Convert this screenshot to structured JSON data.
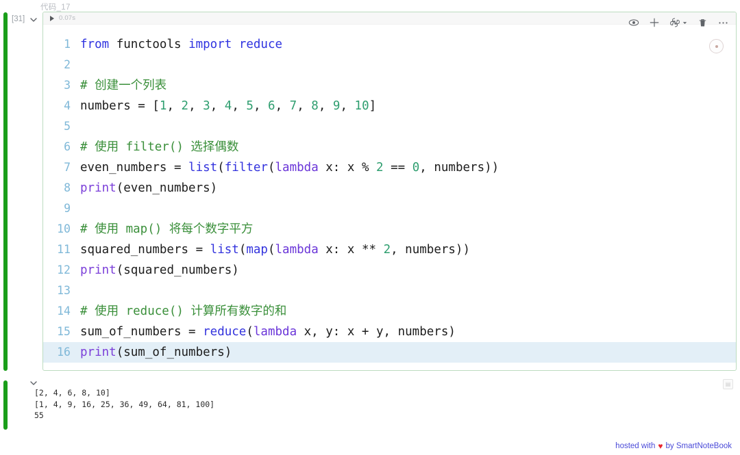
{
  "cell": {
    "label": "代码_17",
    "exec_count": "[31]",
    "exec_time": "0.07s",
    "border_color": "#bcdcc0",
    "run_bar_color": "#1a9e1a"
  },
  "toolbar": {
    "eye": "eye-icon",
    "add": "plus-icon",
    "kernel": "python-kernel-icon",
    "kernel_chevron": "chevron-down-icon",
    "delete": "trash-icon",
    "more": "ellipsis-icon",
    "kernel_status": "kernel-status-icon"
  },
  "code": {
    "language": "python",
    "highlight_line": 16,
    "lines": [
      {
        "n": "1",
        "tokens": [
          {
            "t": "from",
            "c": "kw"
          },
          {
            "t": " functools ",
            "c": "plain"
          },
          {
            "t": "import",
            "c": "kw"
          },
          {
            "t": " ",
            "c": "plain"
          },
          {
            "t": "reduce",
            "c": "kw"
          }
        ]
      },
      {
        "n": "2",
        "tokens": []
      },
      {
        "n": "3",
        "tokens": [
          {
            "t": "# 创建一个列表",
            "c": "com"
          }
        ]
      },
      {
        "n": "4",
        "tokens": [
          {
            "t": "numbers = [",
            "c": "plain"
          },
          {
            "t": "1",
            "c": "num"
          },
          {
            "t": ", ",
            "c": "plain"
          },
          {
            "t": "2",
            "c": "num"
          },
          {
            "t": ", ",
            "c": "plain"
          },
          {
            "t": "3",
            "c": "num"
          },
          {
            "t": ", ",
            "c": "plain"
          },
          {
            "t": "4",
            "c": "num"
          },
          {
            "t": ", ",
            "c": "plain"
          },
          {
            "t": "5",
            "c": "num"
          },
          {
            "t": ", ",
            "c": "plain"
          },
          {
            "t": "6",
            "c": "num"
          },
          {
            "t": ", ",
            "c": "plain"
          },
          {
            "t": "7",
            "c": "num"
          },
          {
            "t": ", ",
            "c": "plain"
          },
          {
            "t": "8",
            "c": "num"
          },
          {
            "t": ", ",
            "c": "plain"
          },
          {
            "t": "9",
            "c": "num"
          },
          {
            "t": ", ",
            "c": "plain"
          },
          {
            "t": "10",
            "c": "num"
          },
          {
            "t": "]",
            "c": "plain"
          }
        ]
      },
      {
        "n": "5",
        "tokens": []
      },
      {
        "n": "6",
        "tokens": [
          {
            "t": "# 使用 filter() 选择偶数",
            "c": "com"
          }
        ]
      },
      {
        "n": "7",
        "tokens": [
          {
            "t": "even_numbers = ",
            "c": "plain"
          },
          {
            "t": "list",
            "c": "builtin"
          },
          {
            "t": "(",
            "c": "plain"
          },
          {
            "t": "filter",
            "c": "builtin"
          },
          {
            "t": "(",
            "c": "plain"
          },
          {
            "t": "lambda",
            "c": "lambda"
          },
          {
            "t": " x: x % ",
            "c": "plain"
          },
          {
            "t": "2",
            "c": "num"
          },
          {
            "t": " == ",
            "c": "plain"
          },
          {
            "t": "0",
            "c": "num"
          },
          {
            "t": ", numbers))",
            "c": "plain"
          }
        ]
      },
      {
        "n": "8",
        "tokens": [
          {
            "t": "print",
            "c": "print"
          },
          {
            "t": "(even_numbers)",
            "c": "plain"
          }
        ]
      },
      {
        "n": "9",
        "tokens": []
      },
      {
        "n": "10",
        "tokens": [
          {
            "t": "# 使用 map() 将每个数字平方",
            "c": "com"
          }
        ]
      },
      {
        "n": "11",
        "tokens": [
          {
            "t": "squared_numbers = ",
            "c": "plain"
          },
          {
            "t": "list",
            "c": "builtin"
          },
          {
            "t": "(",
            "c": "plain"
          },
          {
            "t": "map",
            "c": "builtin"
          },
          {
            "t": "(",
            "c": "plain"
          },
          {
            "t": "lambda",
            "c": "lambda"
          },
          {
            "t": " x: x ** ",
            "c": "plain"
          },
          {
            "t": "2",
            "c": "num"
          },
          {
            "t": ", numbers))",
            "c": "plain"
          }
        ]
      },
      {
        "n": "12",
        "tokens": [
          {
            "t": "print",
            "c": "print"
          },
          {
            "t": "(squared_numbers)",
            "c": "plain"
          }
        ]
      },
      {
        "n": "13",
        "tokens": []
      },
      {
        "n": "14",
        "tokens": [
          {
            "t": "# 使用 reduce() 计算所有数字的和",
            "c": "com"
          }
        ]
      },
      {
        "n": "15",
        "tokens": [
          {
            "t": "sum_of_numbers = ",
            "c": "plain"
          },
          {
            "t": "reduce",
            "c": "builtin"
          },
          {
            "t": "(",
            "c": "plain"
          },
          {
            "t": "lambda",
            "c": "lambda"
          },
          {
            "t": " x, y: x + y, numbers)",
            "c": "plain"
          }
        ]
      },
      {
        "n": "16",
        "tokens": [
          {
            "t": "print",
            "c": "print"
          },
          {
            "t": "(sum_of_numbers)",
            "c": "plain"
          }
        ]
      }
    ]
  },
  "output": {
    "lines": [
      "[2, 4, 6, 8, 10]",
      "[1, 4, 9, 16, 25, 36, 49, 64, 81, 100]",
      "55"
    ],
    "tool_icon": "output-settings-icon"
  },
  "footer": {
    "prefix": "hosted with",
    "heart": "♥",
    "suffix": "by SmartNoteBook",
    "link_color": "#4a4ad8",
    "heart_color": "#e8262f"
  }
}
